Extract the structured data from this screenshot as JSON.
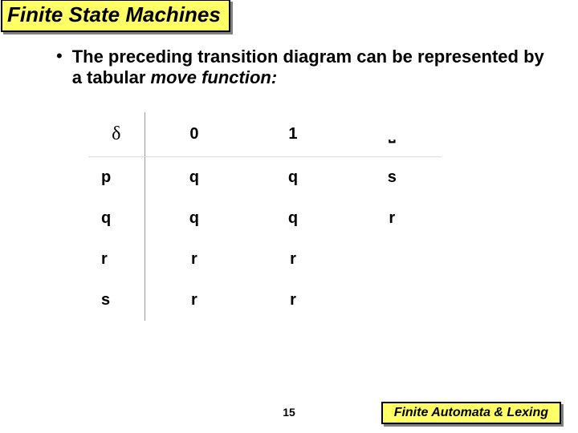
{
  "title": "Finite State Machines",
  "bullet_pre": "The preceding transition diagram can be represented by a tabular ",
  "bullet_ital": "move function:",
  "chart_data": {
    "type": "table",
    "title": "move function",
    "columns": [
      "δ",
      "0",
      "1",
      "⎵"
    ],
    "rows": [
      [
        "p",
        "q",
        "q",
        "s"
      ],
      [
        "q",
        "q",
        "q",
        "r"
      ],
      [
        "r",
        "r",
        "r",
        ""
      ],
      [
        "s",
        "r",
        "r",
        ""
      ]
    ]
  },
  "page_number": "15",
  "footer": "Finite Automata & Lexing"
}
